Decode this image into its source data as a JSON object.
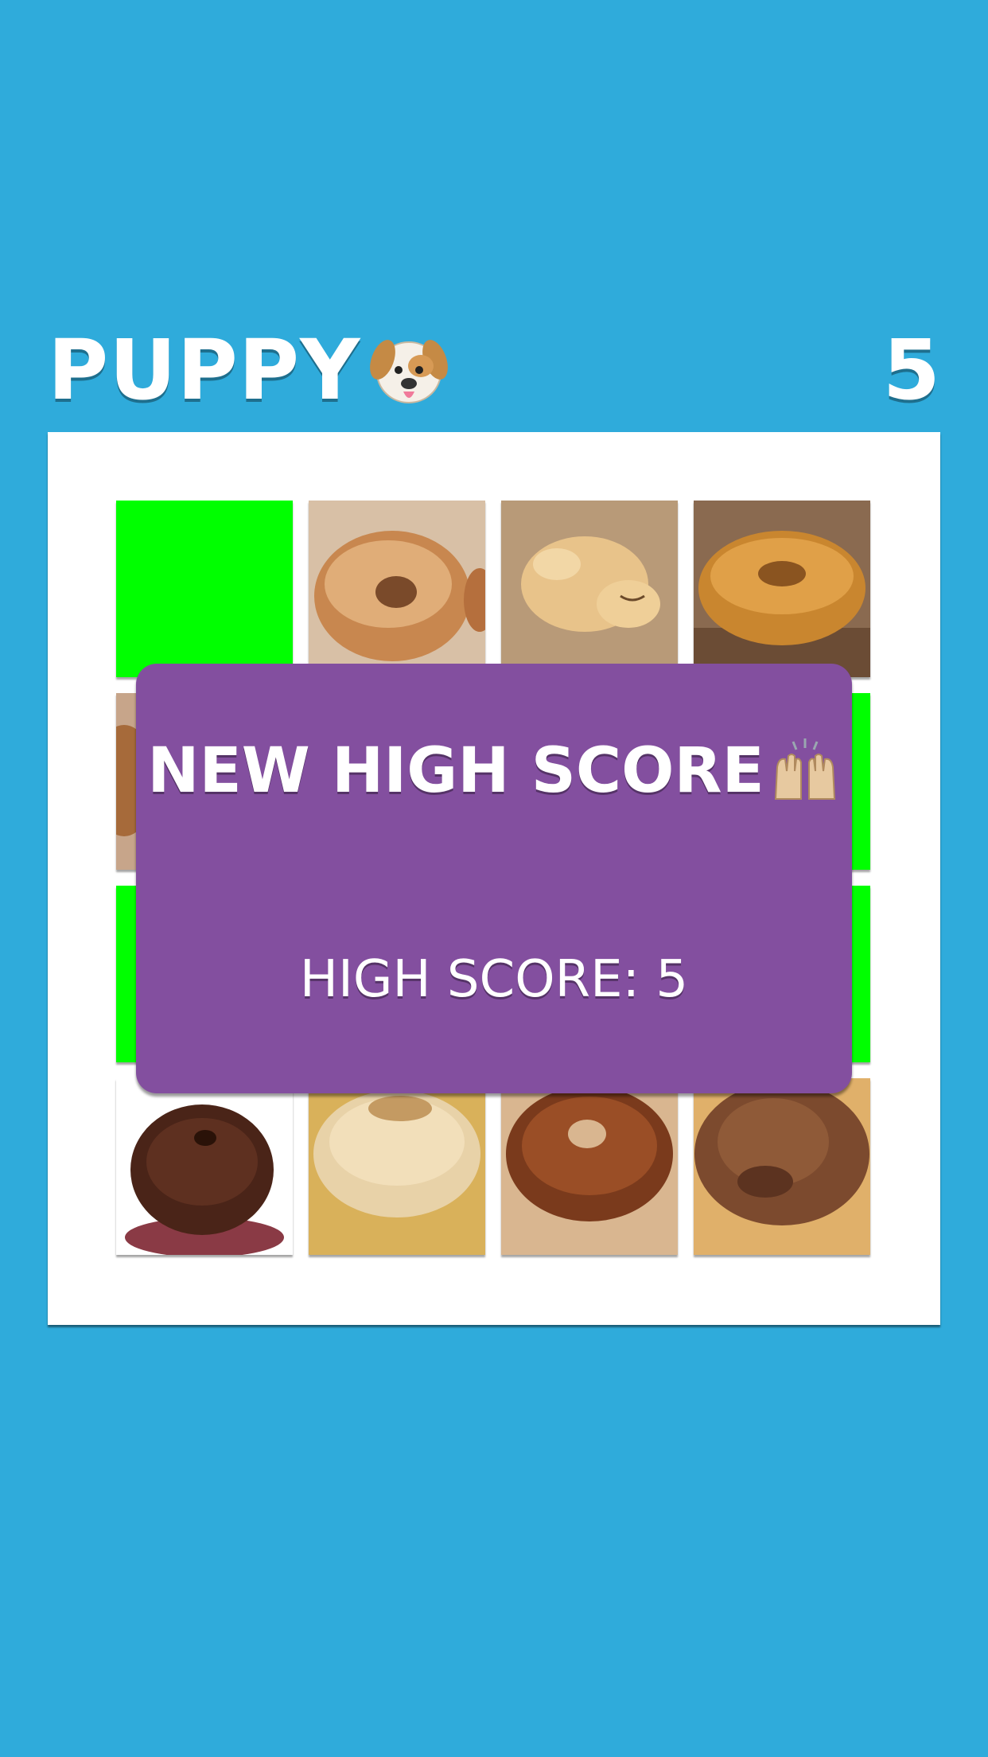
{
  "header": {
    "title": "PUPPY",
    "title_icon": "dog-face-emoji",
    "score": "5"
  },
  "board": {
    "tiles": [
      {
        "kind": "revealed"
      },
      {
        "kind": "bagel"
      },
      {
        "kind": "puppy"
      },
      {
        "kind": "bagel"
      },
      {
        "kind": "bagel"
      },
      {
        "kind": "hidden"
      },
      {
        "kind": "hidden"
      },
      {
        "kind": "revealed"
      },
      {
        "kind": "revealed"
      },
      {
        "kind": "hidden"
      },
      {
        "kind": "hidden"
      },
      {
        "kind": "revealed"
      },
      {
        "kind": "bagel"
      },
      {
        "kind": "bagel"
      },
      {
        "kind": "bagel"
      },
      {
        "kind": "puppy"
      }
    ]
  },
  "overlay": {
    "title": "NEW HIGH SCORE",
    "title_icon": "raising-hands-emoji",
    "high_score_text": "HIGH SCORE: 5"
  },
  "colors": {
    "background": "#2fabdb",
    "board": "#ffffff",
    "revealed_tile": "#00ff00",
    "overlay": "#834f9f"
  }
}
